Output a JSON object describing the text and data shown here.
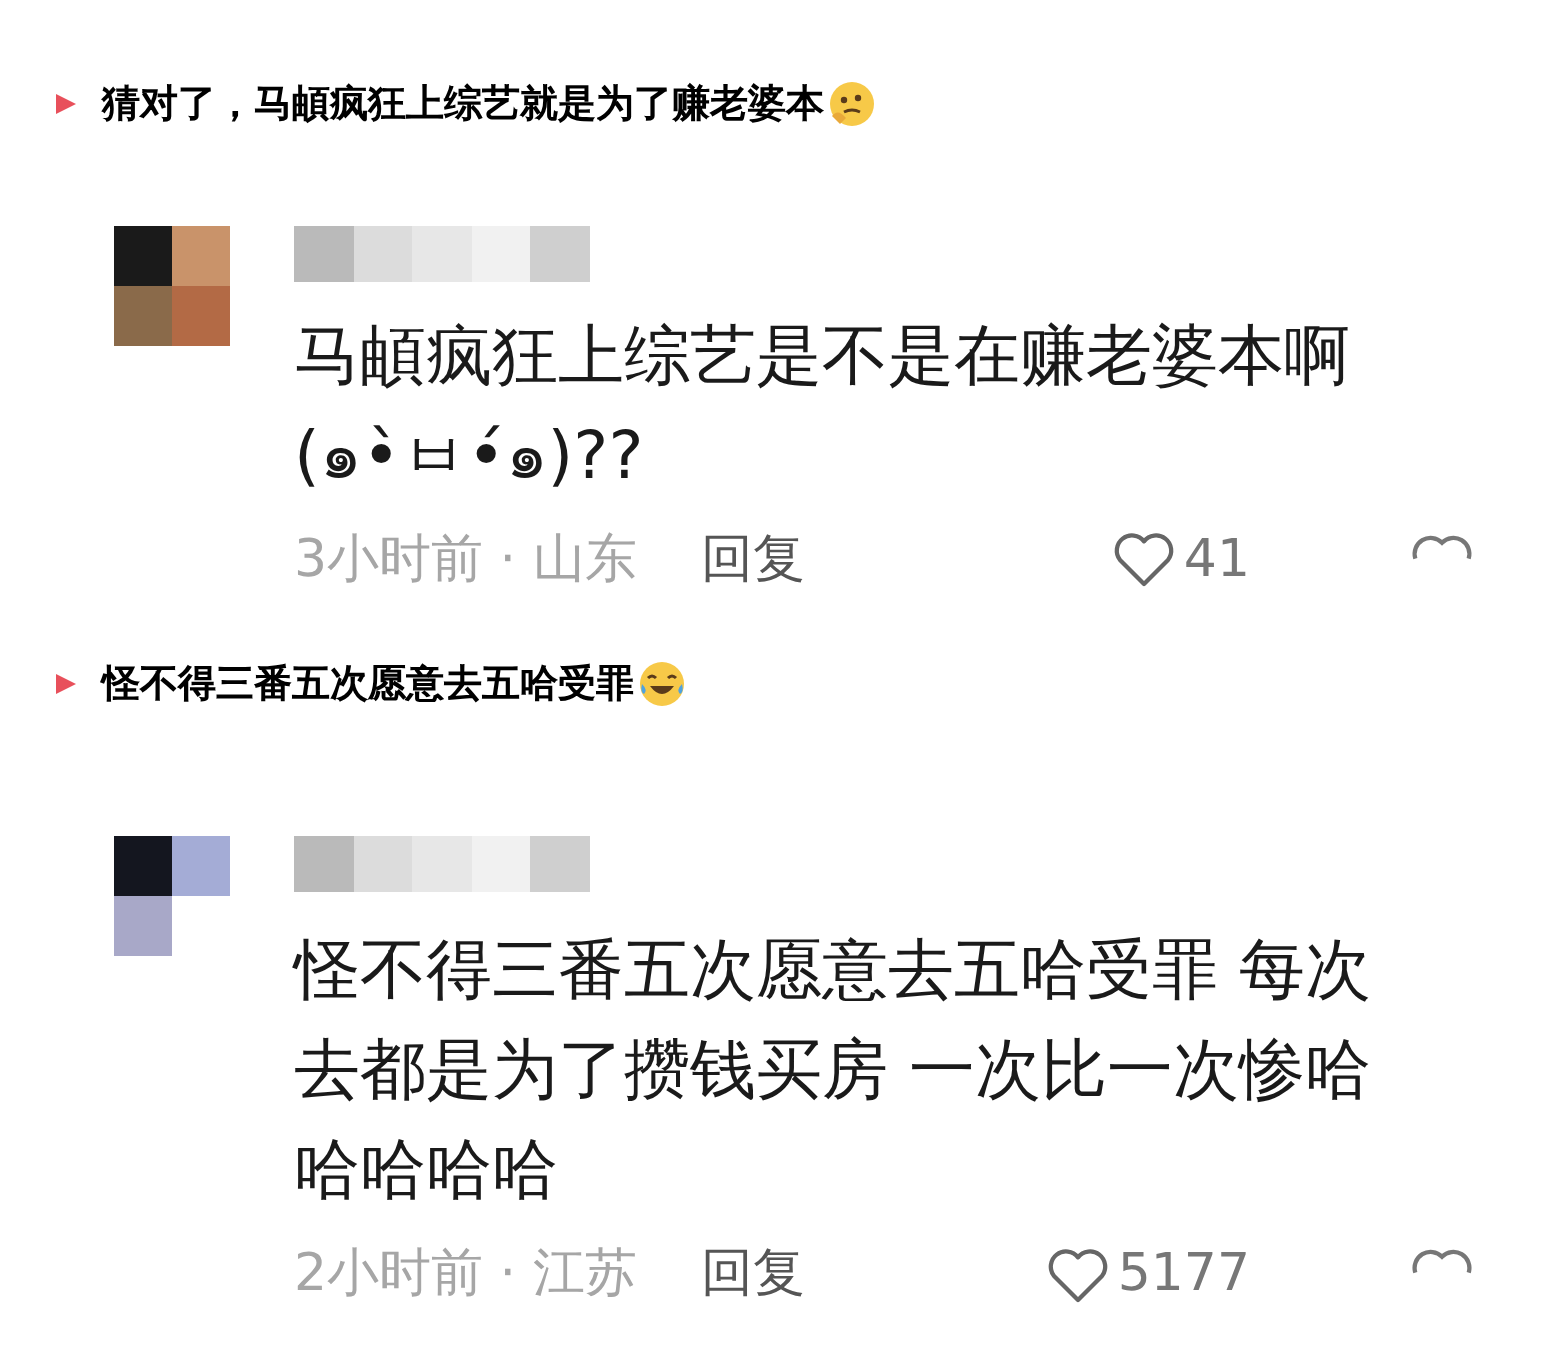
{
  "sections": [
    {
      "heading": "猜对了，马頔疯狂上综艺就是为了赚老婆本",
      "emoji": {
        "kind": "thinking"
      },
      "comment": {
        "lines": [
          "马頔疯狂上综艺是不是在赚老婆本啊",
          "(๑•̀ㅂ•́๑)??"
        ],
        "time": "3小时前 · 山东",
        "reply": "回复",
        "likes": "41"
      }
    },
    {
      "heading": "怪不得三番五次愿意去五哈受罪",
      "emoji": {
        "kind": "laughing"
      },
      "comment": {
        "lines": [
          "怪不得三番五次愿意去五哈受罪 每次",
          "去都是为了攒钱买房 一次比一次惨哈",
          "哈哈哈哈"
        ],
        "time": "2小时前 · 江苏",
        "reply": "回复",
        "likes": "5177"
      }
    }
  ]
}
